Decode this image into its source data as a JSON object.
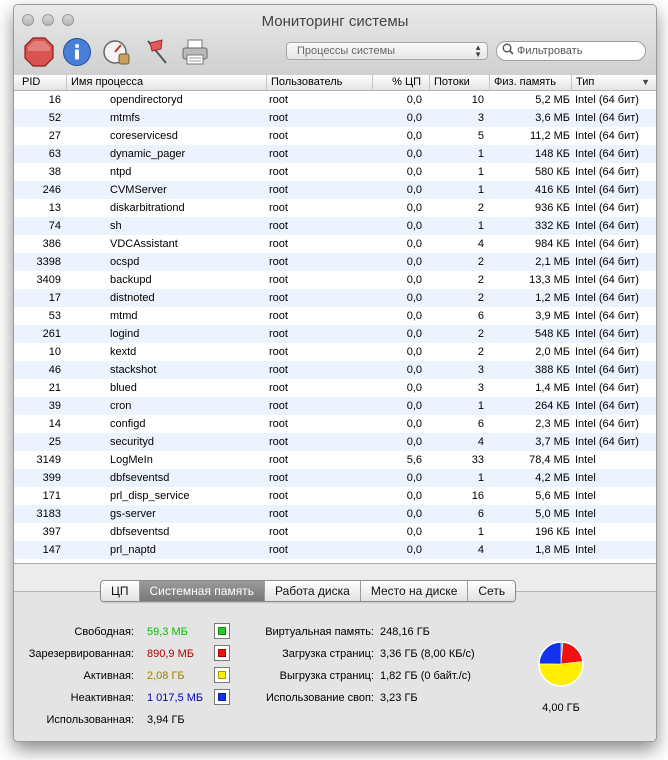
{
  "window": {
    "title": "Мониторинг системы"
  },
  "toolbar": {
    "process_filter": "Процессы системы",
    "search_placeholder": "Фильтровать"
  },
  "columns": [
    "PID",
    "Имя процесса",
    "Пользователь",
    "% ЦП",
    "Потоки",
    "Физ. память",
    "Тип"
  ],
  "processes": [
    {
      "pid": "16",
      "name": "opendirectoryd",
      "user": "root",
      "cpu": "0,0",
      "threads": "10",
      "mem": "5,2 МБ",
      "type": "Intel (64 бит)"
    },
    {
      "pid": "52",
      "name": "mtmfs",
      "user": "root",
      "cpu": "0,0",
      "threads": "3",
      "mem": "3,6 МБ",
      "type": "Intel (64 бит)"
    },
    {
      "pid": "27",
      "name": "coreservicesd",
      "user": "root",
      "cpu": "0,0",
      "threads": "5",
      "mem": "11,2 МБ",
      "type": "Intel (64 бит)"
    },
    {
      "pid": "63",
      "name": "dynamic_pager",
      "user": "root",
      "cpu": "0,0",
      "threads": "1",
      "mem": "148 КБ",
      "type": "Intel (64 бит)"
    },
    {
      "pid": "38",
      "name": "ntpd",
      "user": "root",
      "cpu": "0,0",
      "threads": "1",
      "mem": "580 КБ",
      "type": "Intel (64 бит)"
    },
    {
      "pid": "246",
      "name": "CVMServer",
      "user": "root",
      "cpu": "0,0",
      "threads": "1",
      "mem": "416 КБ",
      "type": "Intel (64 бит)"
    },
    {
      "pid": "13",
      "name": "diskarbitrationd",
      "user": "root",
      "cpu": "0,0",
      "threads": "2",
      "mem": "936 КБ",
      "type": "Intel (64 бит)"
    },
    {
      "pid": "74",
      "name": "sh",
      "user": "root",
      "cpu": "0,0",
      "threads": "1",
      "mem": "332 КБ",
      "type": "Intel (64 бит)"
    },
    {
      "pid": "386",
      "name": "VDCAssistant",
      "user": "root",
      "cpu": "0,0",
      "threads": "4",
      "mem": "984 КБ",
      "type": "Intel (64 бит)"
    },
    {
      "pid": "3398",
      "name": "ocspd",
      "user": "root",
      "cpu": "0,0",
      "threads": "2",
      "mem": "2,1 МБ",
      "type": "Intel (64 бит)"
    },
    {
      "pid": "3409",
      "name": "backupd",
      "user": "root",
      "cpu": "0,0",
      "threads": "2",
      "mem": "13,3 МБ",
      "type": "Intel (64 бит)"
    },
    {
      "pid": "17",
      "name": "distnoted",
      "user": "root",
      "cpu": "0,0",
      "threads": "2",
      "mem": "1,2 МБ",
      "type": "Intel (64 бит)"
    },
    {
      "pid": "53",
      "name": "mtmd",
      "user": "root",
      "cpu": "0,0",
      "threads": "6",
      "mem": "3,9 МБ",
      "type": "Intel (64 бит)"
    },
    {
      "pid": "261",
      "name": "logind",
      "user": "root",
      "cpu": "0,0",
      "threads": "2",
      "mem": "548 КБ",
      "type": "Intel (64 бит)"
    },
    {
      "pid": "10",
      "name": "kextd",
      "user": "root",
      "cpu": "0,0",
      "threads": "2",
      "mem": "2,0 МБ",
      "type": "Intel (64 бит)"
    },
    {
      "pid": "46",
      "name": "stackshot",
      "user": "root",
      "cpu": "0,0",
      "threads": "3",
      "mem": "388 КБ",
      "type": "Intel (64 бит)"
    },
    {
      "pid": "21",
      "name": "blued",
      "user": "root",
      "cpu": "0,0",
      "threads": "3",
      "mem": "1,4 МБ",
      "type": "Intel (64 бит)"
    },
    {
      "pid": "39",
      "name": "cron",
      "user": "root",
      "cpu": "0,0",
      "threads": "1",
      "mem": "264 КБ",
      "type": "Intel (64 бит)"
    },
    {
      "pid": "14",
      "name": "configd",
      "user": "root",
      "cpu": "0,0",
      "threads": "6",
      "mem": "2,3 МБ",
      "type": "Intel (64 бит)"
    },
    {
      "pid": "25",
      "name": "securityd",
      "user": "root",
      "cpu": "0,0",
      "threads": "4",
      "mem": "3,7 МБ",
      "type": "Intel (64 бит)"
    },
    {
      "pid": "3149",
      "name": "LogMeIn",
      "user": "root",
      "cpu": "5,6",
      "threads": "33",
      "mem": "78,4 МБ",
      "type": "Intel"
    },
    {
      "pid": "399",
      "name": "dbfseventsd",
      "user": "root",
      "cpu": "0,0",
      "threads": "1",
      "mem": "4,2 МБ",
      "type": "Intel"
    },
    {
      "pid": "171",
      "name": "prl_disp_service",
      "user": "root",
      "cpu": "0,0",
      "threads": "16",
      "mem": "5,6 МБ",
      "type": "Intel"
    },
    {
      "pid": "3183",
      "name": "gs-server",
      "user": "root",
      "cpu": "0,0",
      "threads": "6",
      "mem": "5,0 МБ",
      "type": "Intel"
    },
    {
      "pid": "397",
      "name": "dbfseventsd",
      "user": "root",
      "cpu": "0,0",
      "threads": "1",
      "mem": "196 КБ",
      "type": "Intel"
    },
    {
      "pid": "147",
      "name": "prl_naptd",
      "user": "root",
      "cpu": "0,0",
      "threads": "4",
      "mem": "1,8 МБ",
      "type": "Intel"
    }
  ],
  "tabs": [
    "ЦП",
    "Системная память",
    "Работа диска",
    "Место на диске",
    "Сеть"
  ],
  "active_tab": 1,
  "memory": {
    "free_label": "Свободная:",
    "free_value": "59,3 МБ",
    "free_color": "#00c000",
    "wired_label": "Зарезервированная:",
    "wired_value": "890,9 МБ",
    "wired_color": "#b00000",
    "active_label": "Активная:",
    "active_value": "2,08 ГБ",
    "active_color": "#a08000",
    "inactive_label": "Неактивная:",
    "inactive_value": "1 017,5 МБ",
    "inactive_color": "#0000c0",
    "used_label": "Использованная:",
    "used_value": "3,94 ГБ",
    "vm_label": "Виртуальная память:",
    "vm_value": "248,16 ГБ",
    "pagein_label": "Загрузка страниц:",
    "pagein_value": "3,36 ГБ (8,00 КБ/с)",
    "pageout_label": "Выгрузка страниц:",
    "pageout_value": "1,82 ГБ (0 байт./с)",
    "swap_label": "Использование своп:",
    "swap_value": "3,23 ГБ",
    "total": "4,00 ГБ"
  },
  "pie": {
    "free_mb": 59.3,
    "wired_mb": 890.9,
    "active_mb": 2129.9,
    "inactive_mb": 1017.5,
    "colors": {
      "free": "#22cc22",
      "wired": "#ee1111",
      "active": "#ffee00",
      "inactive": "#1133ee"
    }
  }
}
